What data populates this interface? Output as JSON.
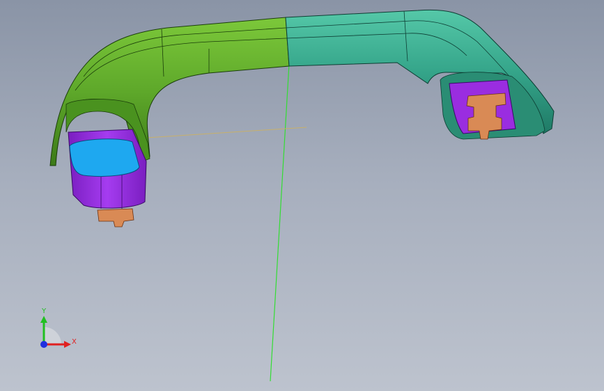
{
  "viewport": {
    "background_top": "#8a94a6",
    "background_bottom": "#bdc3ce"
  },
  "model": {
    "name": "grab-handle-section-view",
    "colors": {
      "handle_left": "#5ea82a",
      "handle_left_dark": "#3c7a18",
      "handle_right": "#35a58a",
      "handle_right_dark": "#1f7a66",
      "clip_purple": "#9a2de0",
      "clip_purple_dark": "#6a18a8",
      "cap_blue": "#1ea8f0",
      "metal_copper": "#d98a55"
    }
  },
  "axes_lines": {
    "vertical_color": "#33dd33",
    "horizontal_color": "#c8b06a"
  },
  "triad": {
    "x_label": "X",
    "y_label": "Y",
    "x_color": "#e02020",
    "y_color": "#20c020",
    "z_color": "#2030e0"
  }
}
